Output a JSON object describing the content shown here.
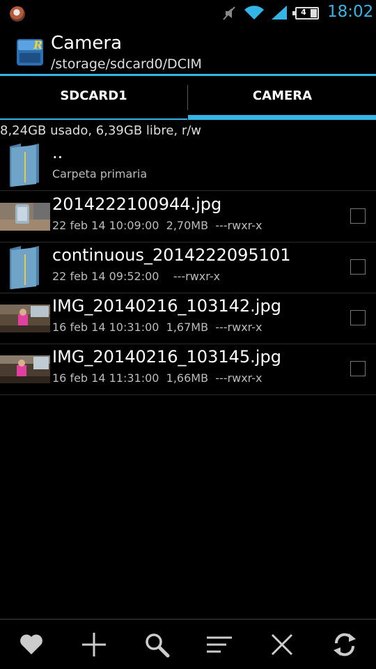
{
  "status_bar": {
    "time": "18:02",
    "battery_level": "4",
    "icons": [
      "notification-icon",
      "mute-icon",
      "wifi-icon",
      "signal-icon",
      "battery-icon"
    ]
  },
  "action_bar": {
    "title": "Camera",
    "path": "/storage/sdcard0/DCIM"
  },
  "tabs": [
    {
      "label": "SDCARD1",
      "selected": false
    },
    {
      "label": "CAMERA",
      "selected": true
    }
  ],
  "storage_info": "8,24GB usado, 6,39GB libre, r/w",
  "files": [
    {
      "name": "..",
      "meta": "Carpeta primaria",
      "type": "parent-folder",
      "checkbox": false
    },
    {
      "name": "2014222100944.jpg",
      "meta": "22 feb 14 10:09:00  2,70MB  ---rwxr-x",
      "type": "image",
      "checkbox": true
    },
    {
      "name": "continuous_2014222095101",
      "meta": "22 feb 14 09:52:00    ---rwxr-x",
      "type": "folder",
      "checkbox": true
    },
    {
      "name": "IMG_20140216_103142.jpg",
      "meta": "16 feb 14 10:31:00  1,67MB  ---rwxr-x",
      "type": "image",
      "checkbox": true
    },
    {
      "name": "IMG_20140216_103145.jpg",
      "meta": "16 feb 14 11:31:00  1,66MB  ---rwxr-x",
      "type": "image",
      "checkbox": true
    }
  ],
  "toolbar": {
    "buttons": [
      "favorite-icon",
      "add-icon",
      "search-icon",
      "sort-icon",
      "close-icon",
      "refresh-icon"
    ]
  },
  "colors": {
    "accent": "#33b5e5",
    "background": "#000000",
    "folder": "#5b8fb5"
  }
}
